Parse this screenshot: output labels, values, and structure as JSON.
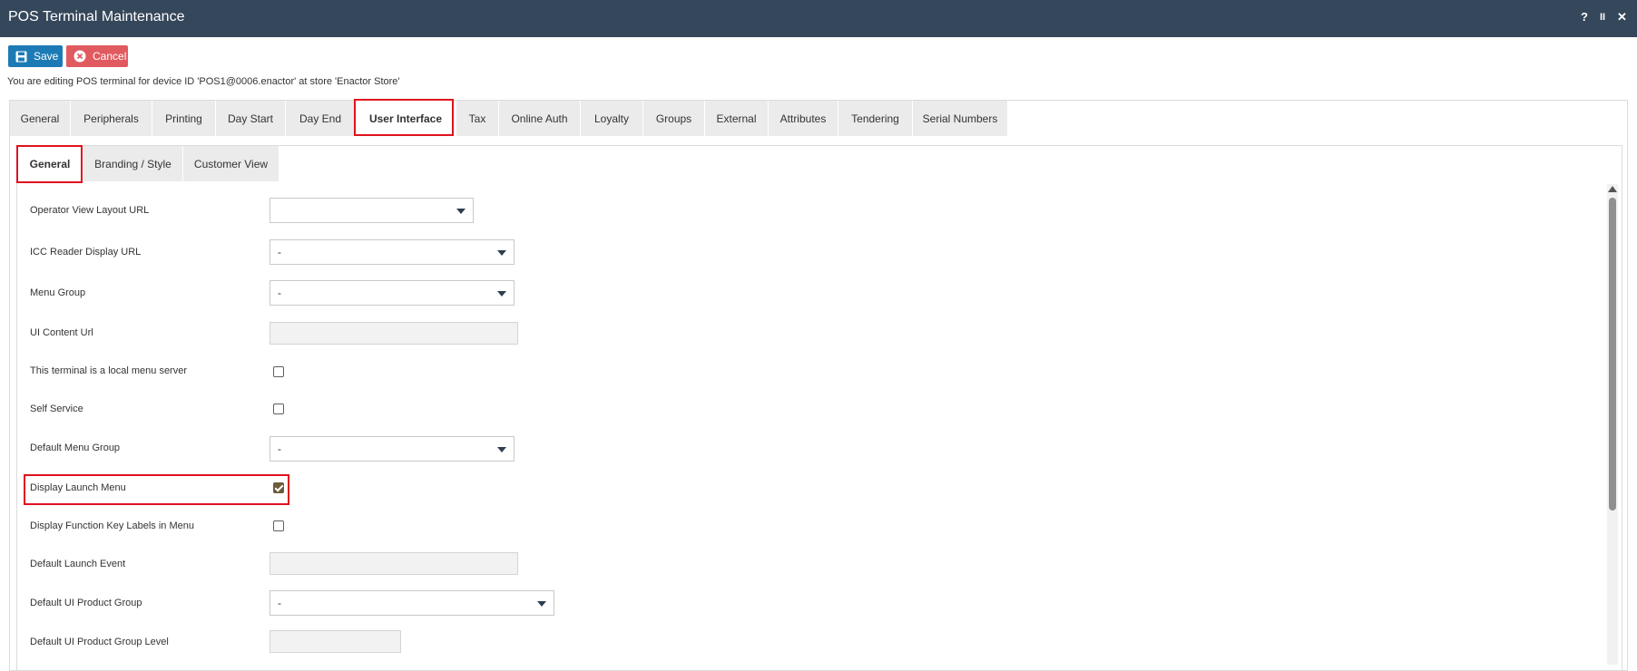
{
  "window": {
    "title": "POS Terminal Maintenance",
    "help_label": "?",
    "pause_label": "II",
    "close_label": "✕"
  },
  "toolbar": {
    "save_label": "Save",
    "cancel_label": "Cancel",
    "save_icon": "floppy-disk-icon",
    "cancel_icon": "circle-x-icon"
  },
  "info_text": "You are editing POS terminal for device ID 'POS1@0006.enactor' at store 'Enactor Store'",
  "main_tabs": [
    "General",
    "Peripherals",
    "Printing",
    "Day Start",
    "Day End",
    "User Interface",
    "Tax",
    "Online Auth",
    "Loyalty",
    "Groups",
    "External",
    "Attributes",
    "Tendering",
    "Serial Numbers"
  ],
  "active_main_tab": "User Interface",
  "sub_tabs": [
    "General",
    "Branding / Style",
    "Customer View"
  ],
  "active_sub_tab": "General",
  "form": {
    "operator_view_layout_url": {
      "label": "Operator View Layout URL",
      "value": ""
    },
    "icc_reader_display_url": {
      "label": "ICC Reader Display URL",
      "value": "-"
    },
    "menu_group": {
      "label": "Menu Group",
      "value": "-"
    },
    "ui_content_url": {
      "label": "UI Content Url",
      "value": ""
    },
    "local_menu_server": {
      "label": "This terminal is a local menu server",
      "checked": false
    },
    "self_service": {
      "label": "Self Service",
      "checked": false
    },
    "default_menu_group": {
      "label": "Default Menu Group",
      "value": "-"
    },
    "display_launch_menu": {
      "label": "Display Launch Menu",
      "checked": true
    },
    "display_fn_key_labels": {
      "label": "Display Function Key Labels in Menu",
      "checked": false
    },
    "default_launch_event": {
      "label": "Default Launch Event",
      "value": ""
    },
    "default_ui_product_group": {
      "label": "Default UI Product Group",
      "value": "-"
    },
    "default_ui_product_group_level": {
      "label": "Default UI Product Group Level",
      "value": ""
    }
  },
  "colors": {
    "titlebar": "#35475a",
    "save_button": "#1c7bb5",
    "cancel_button": "#e05a60",
    "highlight": "#e0121f"
  }
}
